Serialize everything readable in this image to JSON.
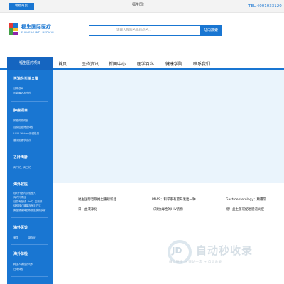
{
  "topbar": {
    "button_label": "瑞福商贸",
    "welcome": "福生国!",
    "tel": "TEL:4001033120"
  },
  "header": {
    "brand_cn": "福生国际医疗",
    "brand_en": "FUSHENG INTL MEDICAL",
    "search_placeholder": "请输入疾病名或药品名...",
    "search_button": "站内搜索"
  },
  "nav": {
    "items": [
      "首页",
      "医药资讯",
      "新闻中心",
      "医学百科",
      "健康学院",
      "联系我们"
    ]
  },
  "sidebar": {
    "title": "福生医药项目",
    "sections": [
      {
        "heading": "可溶性可溶文笺",
        "items": [
          "法规总司",
          "可能最近发出药"
        ]
      },
      {
        "heading": "肿瘤项目",
        "items": [
          "肿瘤药物药品",
          "昆泰癌症筛查体检",
          "HMR Watson肿瘤检测",
          "基于影像学诊疗"
        ]
      },
      {
        "heading": "乙肝丙肝",
        "items": [
          "丙门忙、丙二忙"
        ]
      },
      {
        "heading": "海外就医",
        "items": [
          "现时代各内试验室九",
          "海内外项目",
          "日变专在线（IoT）监测综",
          "体检核心清单及医治方式",
          "胸部健康降低和肠道疾病实新"
        ]
      },
      {
        "heading": "海外医诊",
        "items": [
          "美国",
          "新加坡"
        ]
      },
      {
        "heading": "海外体检",
        "items": [
          "韩国人体检识可科",
          "日本体检"
        ]
      }
    ]
  },
  "news": [
    {
      "title_line1": "福生国际近期推出重磅新品",
      "title_line2": "日：血液净化"
    },
    {
      "title_line1": "PNAS：科学家有望开发出一种",
      "title_line2": "长效抗毒性的HIV药物"
    },
    {
      "title_line1": "Gastroenterology：颠覆常",
      "title_line2": "规！益生菌或促进肠道炎症"
    }
  ],
  "watermark": {
    "logo_text": "JD",
    "brand": "自动秒收录",
    "slogan": "做上链接 → 来访一次 → 自动收录"
  },
  "colors": {
    "primary": "#1976d2",
    "hero_bg": "#eaf4fc"
  }
}
